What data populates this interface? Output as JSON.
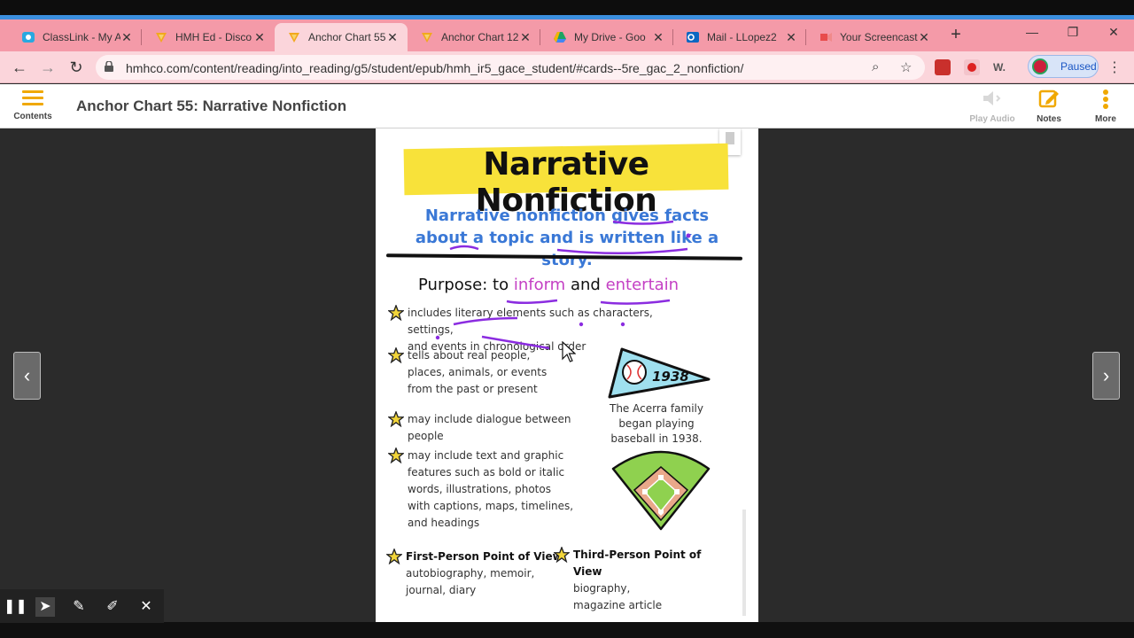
{
  "browser": {
    "tabs": [
      {
        "title": "ClassLink - My A",
        "favicon": "classlink-icon",
        "color": "#29a8e0"
      },
      {
        "title": "HMH Ed - Disco",
        "favicon": "hmh-icon",
        "color": "#f2a81d"
      },
      {
        "title": "Anchor Chart 55",
        "favicon": "hmh-icon",
        "color": "#f2a81d",
        "active": true
      },
      {
        "title": "Anchor Chart 12",
        "favicon": "hmh-icon",
        "color": "#f2a81d"
      },
      {
        "title": "My Drive - Goo",
        "favicon": "google-drive-icon",
        "color": "#1da462"
      },
      {
        "title": "Mail - LLopez2",
        "favicon": "outlook-icon",
        "color": "#0b67c2"
      },
      {
        "title": "Your Screencast",
        "favicon": "screencastify-icon",
        "color": "#e84c4c"
      }
    ],
    "url": "hmhco.com/content/reading/into_reading/g5/student/epub/hmh_ir5_gace_student/#cards--5re_gac_2_nonfiction/",
    "profile_status": "Paused"
  },
  "app": {
    "contents_label": "Contents",
    "page_title": "Anchor Chart 55: Narrative Nonfiction",
    "play_audio_label": "Play Audio",
    "notes_label": "Notes",
    "more_label": "More",
    "accent": "#f0a800"
  },
  "chart": {
    "title": "Narrative Nonfiction",
    "definition": "Narrative nonfiction gives facts about a topic and is written like a story.",
    "purpose_prefix": "Purpose: to",
    "purpose_inform": "inform",
    "purpose_and": "and",
    "purpose_entertain": "entertain",
    "bullets": [
      "includes literary elements such as characters, settings,\nand events in chronological order",
      "tells about real people,\nplaces, animals, or events\nfrom the past or present",
      "may include dialogue between people",
      "may include text and graphic\nfeatures such as bold or italic\nwords, illustrations, photos\nwith captions, maps, timelines,\nand headings"
    ],
    "pennant_year": "1938",
    "caption": "The Acerra family began playing baseball in 1938.",
    "first_person_title": "First-Person Point of View",
    "first_person_text": "autobiography, memoir,\njournal, diary",
    "third_person_title": "Third-Person Point of View",
    "third_person_text": "biography,\nmagazine article"
  }
}
